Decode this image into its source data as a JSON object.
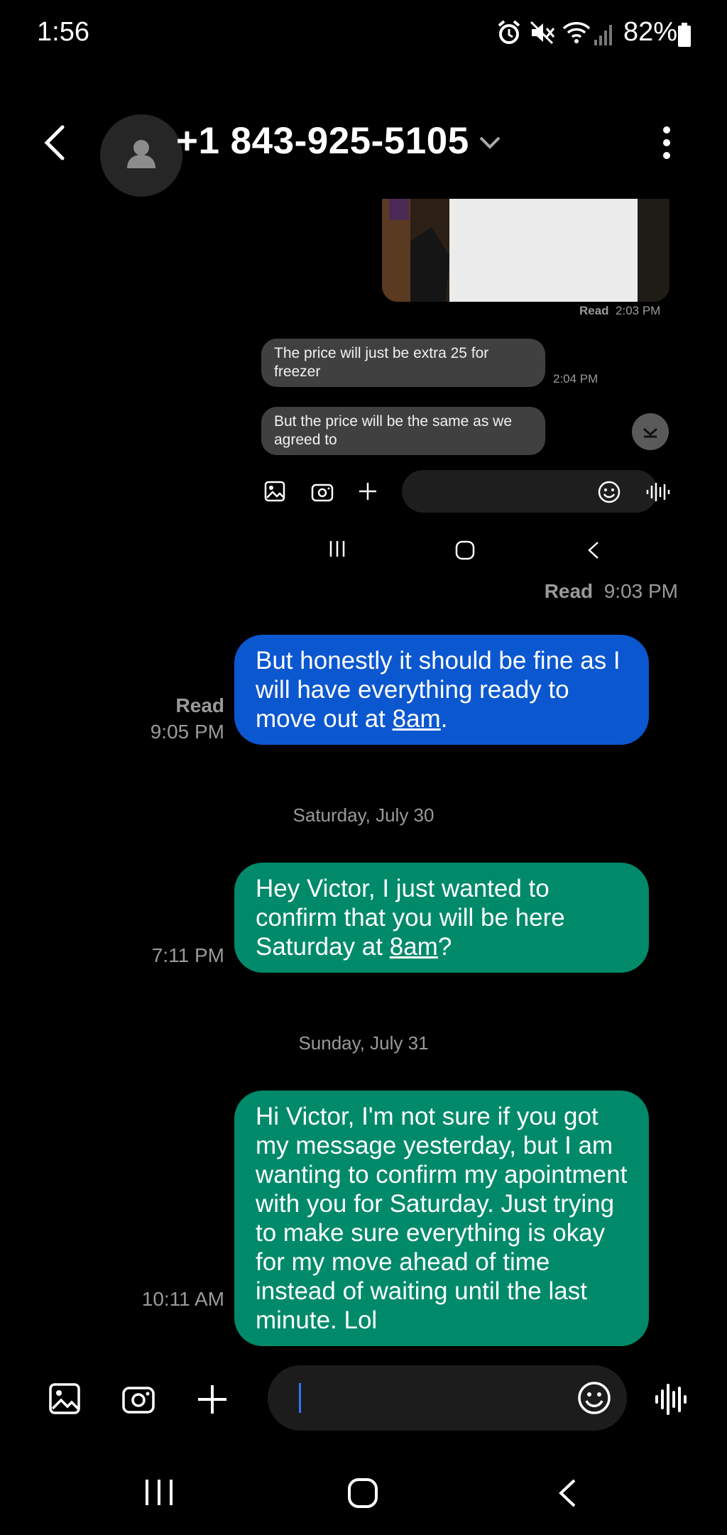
{
  "status_bar": {
    "time": "1:56",
    "battery": "82%"
  },
  "header": {
    "contact": "+1 843-925-5105"
  },
  "embedded_screenshot": {
    "photo_status": "Read",
    "photo_time": "2:03 PM",
    "messages": [
      {
        "text": "The price will just be extra 25 for freezer",
        "time": "2:04 PM"
      },
      {
        "text": "But the price will be the same as we agreed to",
        "time": ""
      }
    ],
    "footer_status": "Read",
    "footer_time": "9:03 PM"
  },
  "conversation": {
    "msg1": {
      "status": "Read",
      "time": "9:05 PM",
      "text_before": "But honestly it should be fine as I will have everything ready to move out at ",
      "link": "8am",
      "text_after": "."
    },
    "date1": "Saturday, July 30",
    "msg2": {
      "time": "7:11 PM",
      "text_before": "Hey Victor, I just wanted to confirm that you will be here Saturday at ",
      "link": "8am",
      "text_after": "?"
    },
    "date2": "Sunday, July 31",
    "msg3": {
      "time": "10:11 AM",
      "text": "Hi Victor, I'm not sure if you got my message yesterday, but I am wanting to confirm my apointment with you for Saturday. Just trying to make sure everything is okay for my move ahead of time instead of waiting until the last minute. Lol"
    }
  },
  "composer": {
    "placeholder": ""
  },
  "colors": {
    "sent_blue": "#0b57d0",
    "sent_green": "#008a6a",
    "background": "#000000"
  }
}
